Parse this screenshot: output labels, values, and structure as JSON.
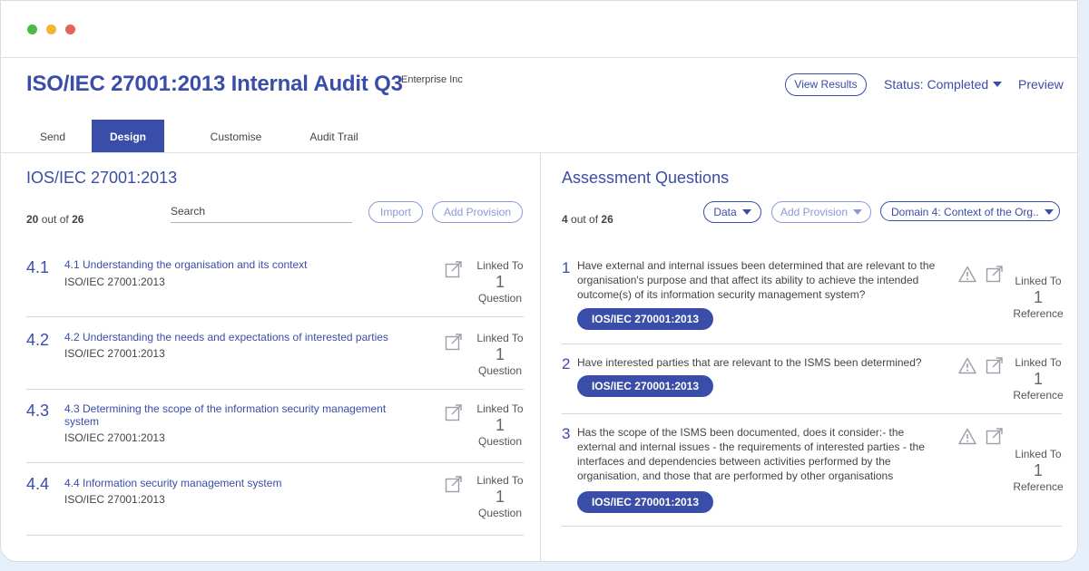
{
  "app": {
    "title": "ISO/IEC 27001:2013 Internal Audit Q3",
    "organization": "Enterprise Inc",
    "view_results_label": "View Results",
    "status_label": "Status: Completed",
    "preview_label": "Preview"
  },
  "tabs": [
    {
      "label": "Send"
    },
    {
      "label": "Design",
      "active": true
    },
    {
      "label": "Customise"
    },
    {
      "label": "Audit Trail"
    }
  ],
  "left_panel": {
    "title": "IOS/IEC 27001:2013",
    "count_shown": "20",
    "count_mid": " out of ",
    "count_total": "26",
    "search_label": "Search",
    "import_label": "Import",
    "add_provision_label": "Add Provision",
    "provisions": [
      {
        "number": "4.1",
        "title": "4.1 Understanding the organisation and its context",
        "standard": "ISO/IEC 27001:2013",
        "linked_label": "Linked To",
        "linked_count": "1",
        "linked_unit": "Question"
      },
      {
        "number": "4.2",
        "title": "4.2 Understanding the needs and expectations of interested parties",
        "standard": "ISO/IEC 27001:2013",
        "linked_label": "Linked To",
        "linked_count": "1",
        "linked_unit": "Question"
      },
      {
        "number": "4.3",
        "title": "4.3 Determining the scope of the information security management system",
        "standard": "ISO/IEC 27001:2013",
        "linked_label": "Linked To",
        "linked_count": "1",
        "linked_unit": "Question"
      },
      {
        "number": "4.4",
        "title": "4.4 Information security management system",
        "standard": "ISO/IEC 27001:2013",
        "linked_label": "Linked To",
        "linked_count": "1",
        "linked_unit": "Question"
      }
    ]
  },
  "right_panel": {
    "title": "Assessment Questions",
    "count_shown": "4",
    "count_mid": " out of ",
    "count_total": "26",
    "data_label": "Data",
    "add_provision_label": "Add Provision",
    "domain_label": "Domain 4: Context of the Org..",
    "questions": [
      {
        "number": "1",
        "text": "Have external and internal issues been determined that are relevant to the organisation's purpose and that affect its ability to achieve the intended outcome(s) of its information security management system?",
        "tag": "IOS/IEC 270001:2013",
        "linked_label": "Linked To",
        "linked_count": "1",
        "linked_unit": "Reference"
      },
      {
        "number": "2",
        "text": "Have interested parties that are relevant to the ISMS been determined?",
        "tag": "IOS/IEC 270001:2013",
        "linked_label": "Linked To",
        "linked_count": "1",
        "linked_unit": "Reference"
      },
      {
        "number": "3",
        "text": "Has the scope of the ISMS been documented, does it consider:- the external and internal issues - the requirements of interested parties - the interfaces and dependencies between activities performed by the organisation, and those that are performed by other organisations",
        "tag": "IOS/IEC 270001:2013",
        "linked_label": "Linked To",
        "linked_count": "1",
        "linked_unit": "Reference"
      }
    ]
  },
  "colors": {
    "accent": "#3a4da8",
    "muted_accent": "#8a9ad6",
    "page_background": "#e7effa"
  },
  "icons": [
    "window-close-dot",
    "window-minimize-dot",
    "window-maximize-dot",
    "caret-down-icon",
    "edit-link-icon",
    "warning-icon"
  ]
}
